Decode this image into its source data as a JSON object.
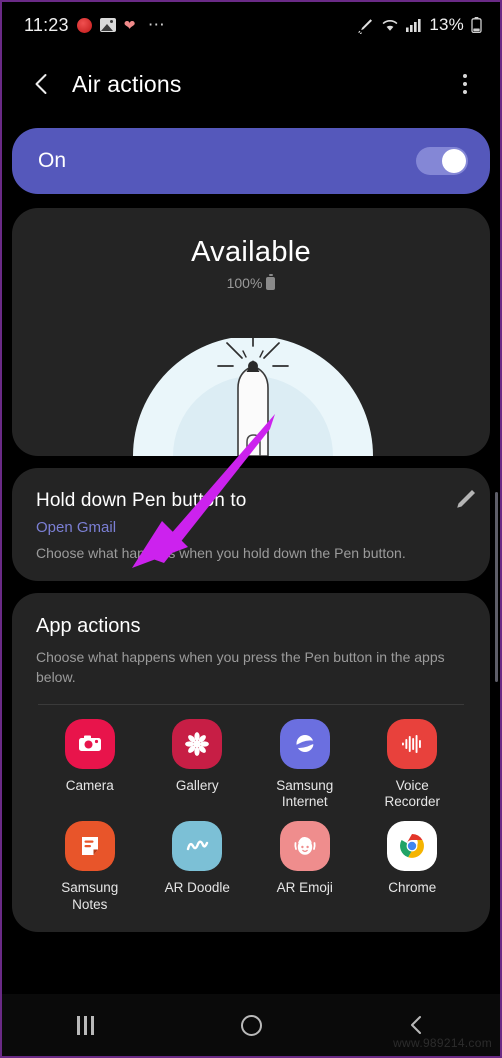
{
  "statusbar": {
    "time": "11:23",
    "icons_left": [
      "red-app-icon",
      "photo-icon",
      "heart-icon",
      "more-dots-icon"
    ],
    "icons_right": [
      "spen-icon",
      "wifi-icon",
      "signal-icon",
      "battery-icon"
    ],
    "battery_percent": "13%"
  },
  "appbar": {
    "back": "back-arrow",
    "title": "Air actions",
    "menu": "more-options"
  },
  "toggle": {
    "label": "On",
    "state": "on",
    "accent_color": "#5558bb"
  },
  "status_card": {
    "title": "Available",
    "battery": "100%",
    "illustration": "s-pen-signal-illustration"
  },
  "hold_action": {
    "title": "Hold down Pen button to",
    "value": "Open Gmail",
    "value_color": "#7b7fd4",
    "description": "Choose what happens when you hold down the Pen button.",
    "edit_icon": "pencil-icon"
  },
  "app_actions": {
    "title": "App actions",
    "description": "Choose what happens when you press the Pen button in the apps below.",
    "apps": [
      {
        "label": "Camera",
        "icon": "camera-icon",
        "bg": "#e8144b"
      },
      {
        "label": "Gallery",
        "icon": "gallery-flower-icon",
        "bg": "#c71e45"
      },
      {
        "label": "Samsung\nInternet",
        "icon": "samsung-internet-icon",
        "bg": "#6b6fe0"
      },
      {
        "label": "Voice\nRecorder",
        "icon": "voice-waveform-icon",
        "bg": "#e8413c"
      },
      {
        "label": "Samsung\nNotes",
        "icon": "notes-icon",
        "bg": "#e8552a"
      },
      {
        "label": "AR Doodle",
        "icon": "ar-doodle-icon",
        "bg": "#7cc0d6"
      },
      {
        "label": "AR Emoji",
        "icon": "ar-emoji-icon",
        "bg": "#ef8d8d"
      },
      {
        "label": "Chrome",
        "icon": "chrome-icon",
        "bg": "#ffffff"
      }
    ]
  },
  "navbar": {
    "recent": "recent-apps",
    "home": "home",
    "back": "back"
  },
  "annotation": {
    "arrow": "purple-arrow",
    "color": "#cc22ee"
  },
  "watermark": "www.989214.com"
}
